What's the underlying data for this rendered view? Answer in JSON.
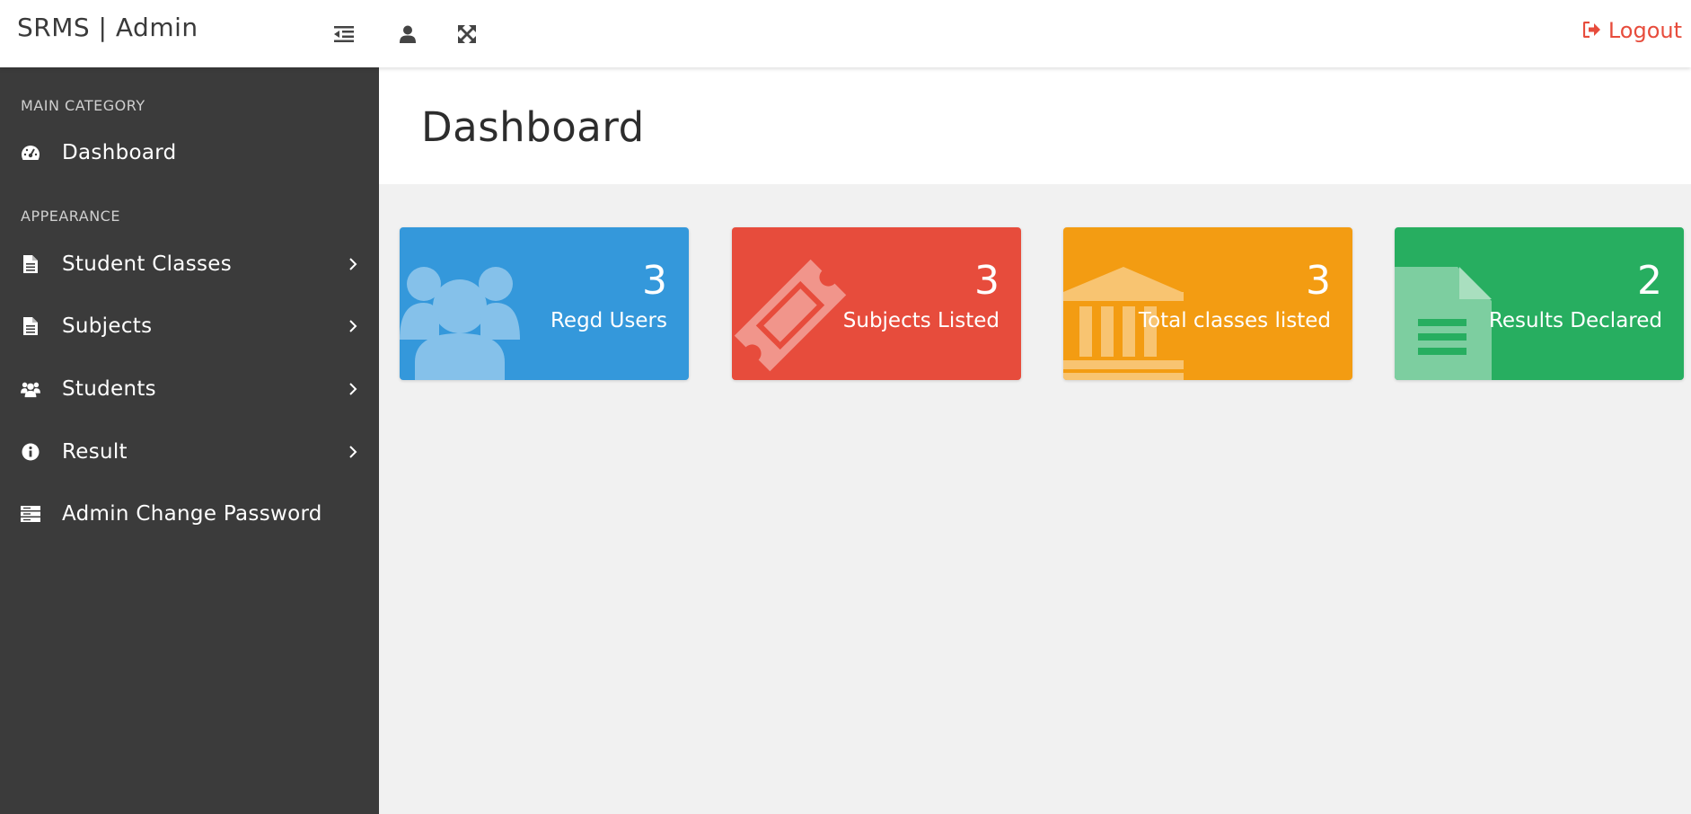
{
  "topbar": {
    "brand": "SRMS | Admin",
    "logout_label": "Logout"
  },
  "sidebar": {
    "main_category": "MAIN CATEGORY",
    "appearance": "APPEARANCE",
    "items": [
      {
        "label": "Dashboard",
        "icon": "dashboard-icon"
      },
      {
        "label": "Student Classes",
        "icon": "file-icon"
      },
      {
        "label": "Subjects",
        "icon": "file-icon"
      },
      {
        "label": "Students",
        "icon": "users-icon"
      },
      {
        "label": "Result",
        "icon": "info-icon"
      },
      {
        "label": "Admin Change Password",
        "icon": "server-icon"
      }
    ]
  },
  "page": {
    "title": "Dashboard"
  },
  "cards": [
    {
      "value": "3",
      "label": "Regd Users",
      "color": "#3498db",
      "icon": "users-icon"
    },
    {
      "value": "3",
      "label": "Subjects Listed",
      "color": "#e74c3c",
      "icon": "ticket-icon"
    },
    {
      "value": "3",
      "label": "Total classes listed",
      "color": "#f39c12",
      "icon": "bank-icon"
    },
    {
      "value": "2",
      "label": "Results Declared",
      "color": "#27ae60",
      "icon": "file-icon"
    }
  ],
  "colors": {
    "sidebar_bg": "#3b3b3b",
    "logout": "#e74c3c",
    "content_bg": "#f1f1f1"
  }
}
